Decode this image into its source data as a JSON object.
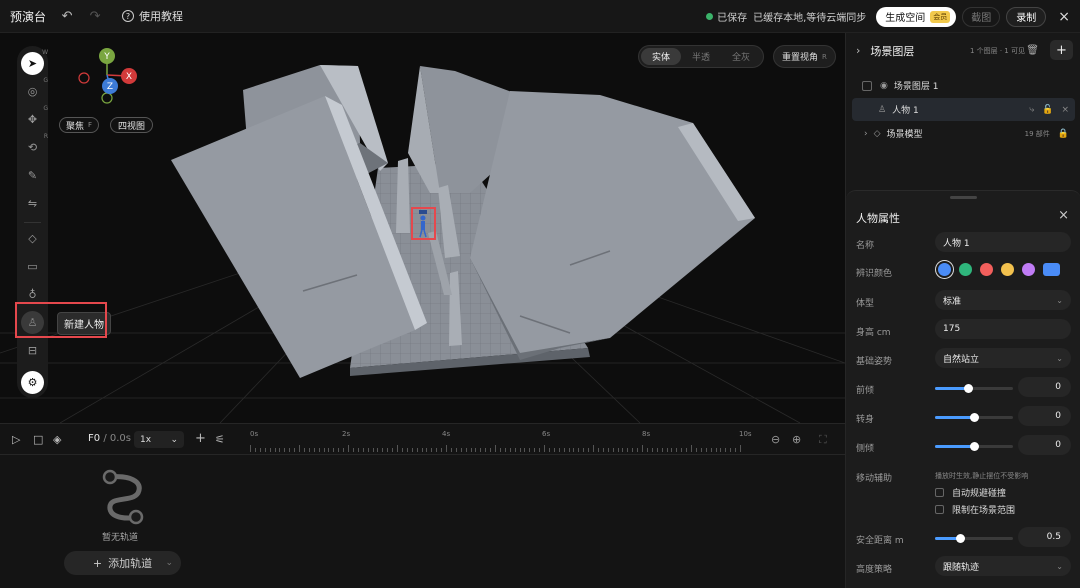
{
  "topbar": {
    "app_title": "预演台",
    "tutorial_label": "使用教程",
    "saved_label": "已保存",
    "sync_status": "已缓存本地,等待云端同步",
    "space_button": "生成空间",
    "vip_badge": "会员",
    "screenshot_button": "截图",
    "record_button": "录制",
    "close_icon": "×"
  },
  "viewport": {
    "gizmo_axes": {
      "y": "Y",
      "x": "X",
      "z": "Z"
    },
    "focus_label": "聚焦",
    "focus_key": "F",
    "quad_view_label": "四视图",
    "view_modes": [
      "实体",
      "半透",
      "全灰"
    ],
    "active_view_mode": "实体",
    "reset_view_label": "重置视角",
    "reset_view_key": "R",
    "tool_keys": {
      "select": "W",
      "orbit": "G",
      "move": "G",
      "rotate": "R"
    },
    "tooltip": "新建人物",
    "figure_tag": "E5"
  },
  "timeline": {
    "frame_label": "F0",
    "time_label": "/ 0.0s",
    "speed": "1x",
    "ruler_labels": [
      "0s",
      "2s",
      "4s",
      "6s",
      "8s",
      "10s"
    ],
    "empty_label": "暂无轨道",
    "add_track_label": "添加轨道"
  },
  "layers": {
    "title": "场景图层",
    "meta": "1 个图层 · 1 可见",
    "items": [
      {
        "label": "场景图层 1"
      },
      {
        "label": "人物 1"
      },
      {
        "label": "场景模型",
        "meta": "19 部件"
      }
    ]
  },
  "props": {
    "title": "人物属性",
    "name_label": "名称",
    "name_value": "人物 1",
    "color_label": "辨识颜色",
    "colors": [
      "#4a8cf7",
      "#2fb67c",
      "#f25f5c",
      "#f2c14e",
      "#c07cf5",
      "#4a8cf7"
    ],
    "body_label": "体型",
    "body_value": "标准",
    "height_label": "身高 cm",
    "height_value": "175",
    "pose_label": "基础姿势",
    "pose_value": "自然站立",
    "lean_label": "前倾",
    "lean_value": "0",
    "lean_pos": 0.42,
    "turn_label": "转身",
    "turn_value": "0",
    "turn_pos": 0.5,
    "tilt_label": "侧倾",
    "tilt_value": "0",
    "tilt_pos": 0.5,
    "move_assist_label": "移动辅助",
    "move_assist_hint": "播放时生效,静止摆位不受影响",
    "auto_avoid_label": "自动规避碰撞",
    "limit_scene_label": "限制在场景范围",
    "safe_dist_label": "安全距离 m",
    "safe_dist_value": "0.5",
    "safe_dist_pos": 0.32,
    "height_policy_label": "高度策略",
    "height_policy_value": "跟随轨迹"
  }
}
